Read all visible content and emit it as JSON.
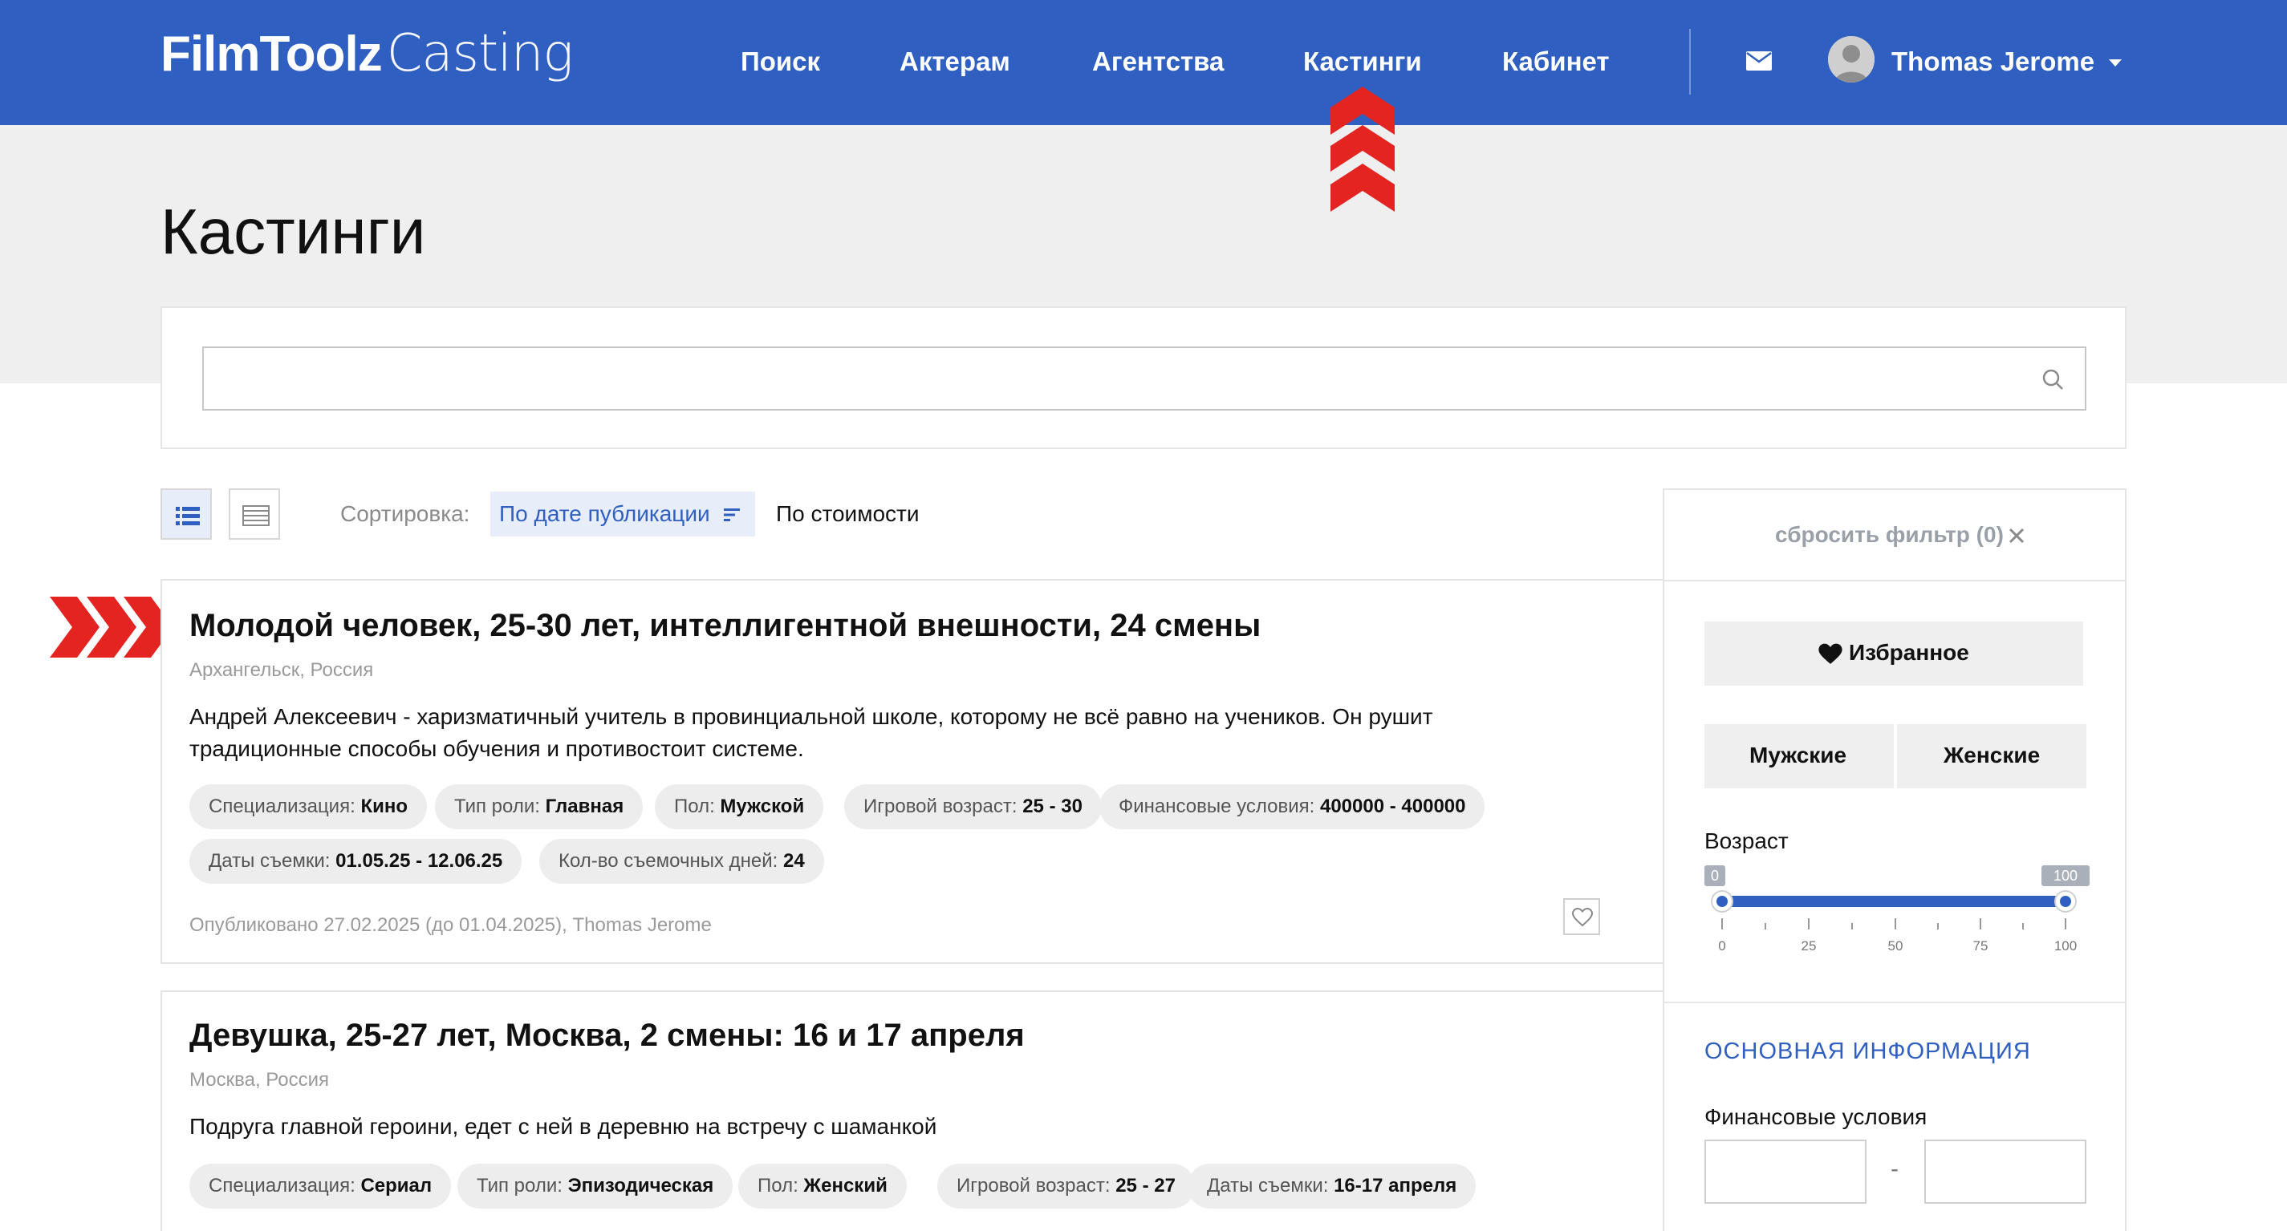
{
  "header": {
    "logo_bold": "FilmToolz",
    "logo_light": "Casting",
    "nav": [
      {
        "label": "Поиск"
      },
      {
        "label": "Актерам"
      },
      {
        "label": "Агентства"
      },
      {
        "label": "Кастинги"
      },
      {
        "label": "Кабинет"
      }
    ],
    "user_name": "Thomas Jerome",
    "icons": [
      "mail-icon",
      "avatar-icon",
      "caret-down-icon"
    ]
  },
  "page": {
    "title": "Кастинги"
  },
  "search": {
    "value": "",
    "placeholder": ""
  },
  "toolbar": {
    "sort_label": "Сортировка:",
    "sort_by_date": "По дате публикации",
    "sort_by_price": "По стоимости"
  },
  "castings": [
    {
      "title": "Молодой человек, 25-30 лет, интеллигентной внешности, 24 смены",
      "location": "Архангельск, Россия",
      "description": "Андрей Алексеевич - харизматичный учитель в провинциальной школе, которому не всё равно на учеников. Он рушит традиционные способы обучения и противостоит системе.",
      "tags": [
        {
          "key": "Специализация:",
          "value": "Кино"
        },
        {
          "key": "Тип роли:",
          "value": "Главная"
        },
        {
          "key": "Пол:",
          "value": "Мужской"
        },
        {
          "key": "Игровой возраст:",
          "value": "25 - 30"
        },
        {
          "key": "Финансовые условия:",
          "value": "400000 - 400000"
        },
        {
          "key": "Даты съемки:",
          "value": "01.05.25 - 12.06.25"
        },
        {
          "key": "Кол-во съемочных дней:",
          "value": "24"
        }
      ],
      "meta": "Опубликовано 27.02.2025 (до 01.04.2025), Thomas Jerome"
    },
    {
      "title": "Девушка, 25-27 лет, Москва, 2 смены: 16 и 17 апреля",
      "location": "Москва, Россия",
      "description": "Подруга главной героини, едет с ней в деревню на встречу с шаманкой",
      "tags": [
        {
          "key": "Специализация:",
          "value": "Сериал"
        },
        {
          "key": "Тип роли:",
          "value": "Эпизодическая"
        },
        {
          "key": "Пол:",
          "value": "Женский"
        },
        {
          "key": "Игровой возраст:",
          "value": "25 - 27"
        },
        {
          "key": "Даты съемки:",
          "value": "16-17 апреля"
        }
      ]
    }
  ],
  "sidebar": {
    "reset_label": "сбросить фильтр (0)",
    "favorites_label": "Избранное",
    "male_label": "Мужские",
    "female_label": "Женские",
    "age_label": "Возраст",
    "age_min": 0,
    "age_max": 100,
    "age_min_badge": "0",
    "age_max_badge": "100",
    "age_ticks": [
      "0",
      "25",
      "50",
      "75",
      "100"
    ],
    "section_heading": "ОСНОВНАЯ ИНФОРМАЦИЯ",
    "finance_label": "Финансовые условия",
    "finance_from": "",
    "finance_to": "",
    "finance_dash": "-"
  },
  "colors": {
    "brand_blue": "#2f5fc0",
    "annotation_red": "#e32421",
    "band_grey": "#efefef"
  }
}
